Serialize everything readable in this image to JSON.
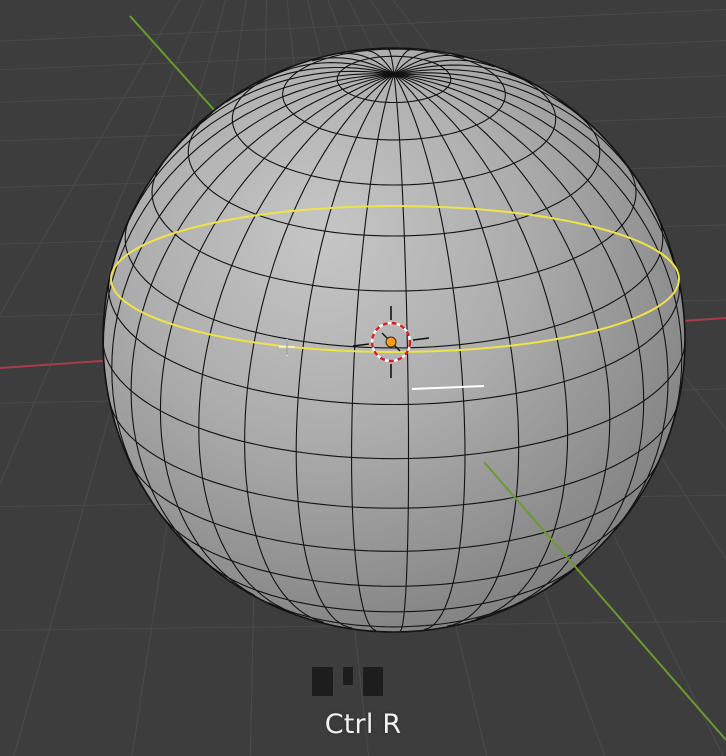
{
  "viewport": {
    "background": "#3d3d3d",
    "grid_color": "#4a4a4a",
    "x_axis_color": "#a83d4a",
    "y_axis_color": "#6b9a2f",
    "mesh_fill": "#a9a9a9",
    "wire_color": "#121212",
    "loop_cut_color": "#f0e24a",
    "selected_edge_color": "#ffffff",
    "origin_color": "#ff9b1f",
    "cursor_colors": [
      "#d42020",
      "#ffffff"
    ]
  },
  "shortcut": {
    "label": "Ctrl R",
    "icon": "mouse-keymap-icon"
  }
}
